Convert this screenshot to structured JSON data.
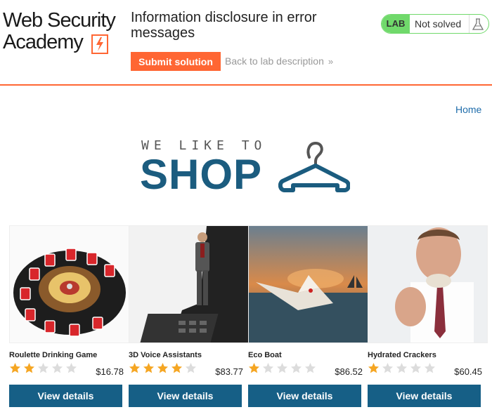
{
  "header": {
    "logo_line1": "Web Security",
    "logo_line2": "Academy",
    "lab_title": "Information disclosure in error messages",
    "submit_label": "Submit solution",
    "back_label": "Back to lab description",
    "status_badge": "LAB",
    "status_text": "Not solved",
    "accent_color": "#ff6633",
    "status_color": "#70d96b"
  },
  "nav": {
    "home_label": "Home"
  },
  "banner": {
    "tagline": "WE LIKE TO",
    "headline": "SHOP"
  },
  "products": [
    {
      "name": "Roulette Drinking Game",
      "rating": 2,
      "max_rating": 5,
      "price": "$16.78",
      "button": "View details",
      "image": "roulette-drinking-game-image"
    },
    {
      "name": "3D Voice Assistants",
      "rating": 4,
      "max_rating": 5,
      "price": "$83.77",
      "button": "View details",
      "image": "voice-assistant-figurine-image"
    },
    {
      "name": "Eco Boat",
      "rating": 1,
      "max_rating": 5,
      "price": "$86.52",
      "button": "View details",
      "image": "paper-boat-image"
    },
    {
      "name": "Hydrated Crackers",
      "rating": 1,
      "max_rating": 5,
      "price": "$60.45",
      "button": "View details",
      "image": "man-eating-cracker-image"
    }
  ],
  "colors": {
    "primary_button": "#165f86",
    "banner_text": "#1b5c7f",
    "link": "#1f6dab",
    "star_filled": "#f5a623",
    "star_empty": "#dcdcdc"
  }
}
